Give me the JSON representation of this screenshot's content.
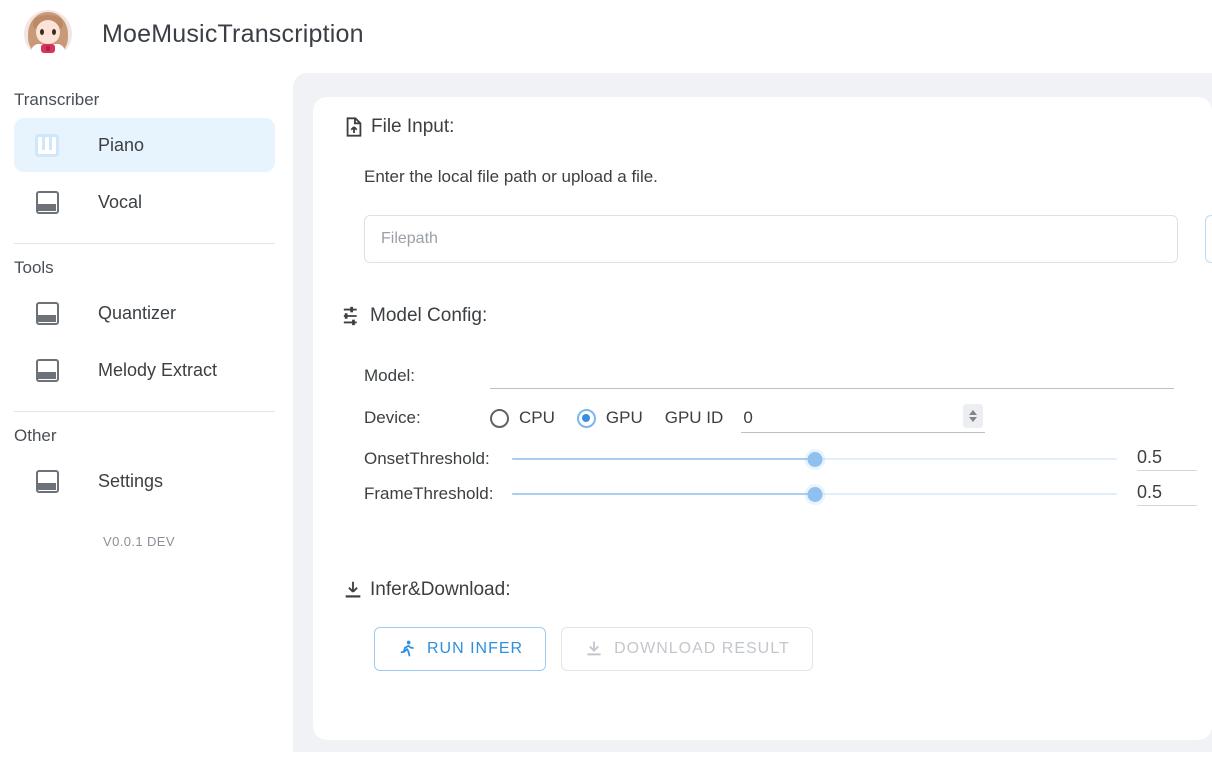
{
  "app": {
    "title": "MoeMusicTranscription",
    "avatar_icon": "anime-girl-avatar",
    "version": "V0.0.1 DEV"
  },
  "sidebar": {
    "sections": [
      {
        "label": "Transcriber",
        "items": [
          {
            "label": "Piano",
            "icon": "piano-keys-icon",
            "active": true
          },
          {
            "label": "Vocal",
            "icon": "placeholder-inbox-icon",
            "active": false
          }
        ]
      },
      {
        "label": "Tools",
        "items": [
          {
            "label": "Quantizer",
            "icon": "placeholder-inbox-icon",
            "active": false
          },
          {
            "label": "Melody Extract",
            "icon": "placeholder-inbox-icon",
            "active": false
          }
        ]
      },
      {
        "label": "Other",
        "items": [
          {
            "label": "Settings",
            "icon": "placeholder-inbox-icon",
            "active": false
          }
        ]
      }
    ]
  },
  "main": {
    "file_input": {
      "heading": "File Input:",
      "heading_icon": "file-upload-icon",
      "description": "Enter the local file path or upload a file.",
      "filepath_value": "",
      "filepath_placeholder": "Filepath",
      "upload_button_label": ""
    },
    "model_config": {
      "heading": "Model Config:",
      "heading_icon": "tune-sliders-icon",
      "model_label": "Model:",
      "model_value": "",
      "device_label": "Device:",
      "device_options": [
        {
          "label": "CPU",
          "selected": false
        },
        {
          "label": "GPU",
          "selected": true
        }
      ],
      "gpu_id_label": "GPU ID",
      "gpu_id_value": "0",
      "sliders": [
        {
          "label": "OnsetThreshold:",
          "value": "0.5",
          "percent": 50
        },
        {
          "label": "FrameThreshold:",
          "value": "0.5",
          "percent": 50
        }
      ]
    },
    "infer": {
      "heading": "Infer&Download:",
      "heading_icon": "download-icon",
      "run_button": {
        "label": "RUN INFER",
        "icon": "running-person-icon",
        "disabled": false
      },
      "download_button": {
        "label": "DOWNLOAD RESULT",
        "icon": "download-icon",
        "disabled": true
      }
    }
  },
  "colors": {
    "accent": "#2e8fe0",
    "active_nav_bg": "#e7f3fd",
    "content_bg": "#f1f2f6",
    "slider_thumb": "#8ec1f0"
  }
}
